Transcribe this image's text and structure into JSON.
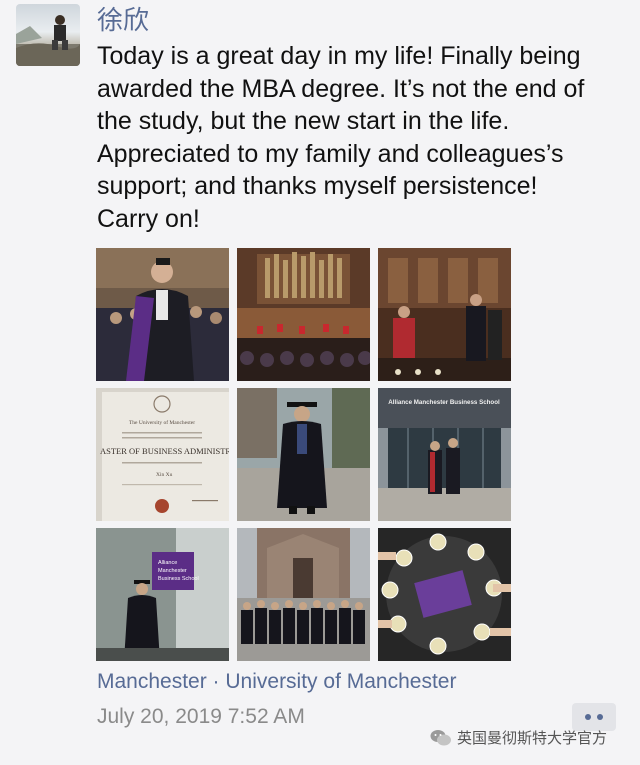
{
  "post": {
    "username": "徐欣",
    "text_lines": [
      "Today is a great day in my life! Finally being",
      "awarded the MBA degree.  It’s not the end of",
      "the study, but the new start in the life.",
      "Appreciated to my family and colleagues’s",
      "support; and thanks myself persistence!",
      "Carry on!"
    ],
    "location": "Manchester · University of Manchester",
    "timestamp": "July 20, 2019 7:52 AM"
  },
  "photos": {
    "certificate": {
      "institution": "The University of Manchester",
      "degree": "ASTER OF BUSINESS ADMINISTRAT",
      "name": "Xin Xu"
    },
    "building_sign": "Alliance Manchester Business School",
    "banner_lines": [
      "Alliance",
      "Manchester",
      "Business School"
    ]
  },
  "watermark": {
    "text": "英国曼彻斯特大学官方"
  },
  "colors": {
    "link": "#576b95",
    "text": "#111111",
    "muted": "#8a8a8a",
    "background": "#f4f4f6",
    "purple_gown": "#5b2d86"
  }
}
